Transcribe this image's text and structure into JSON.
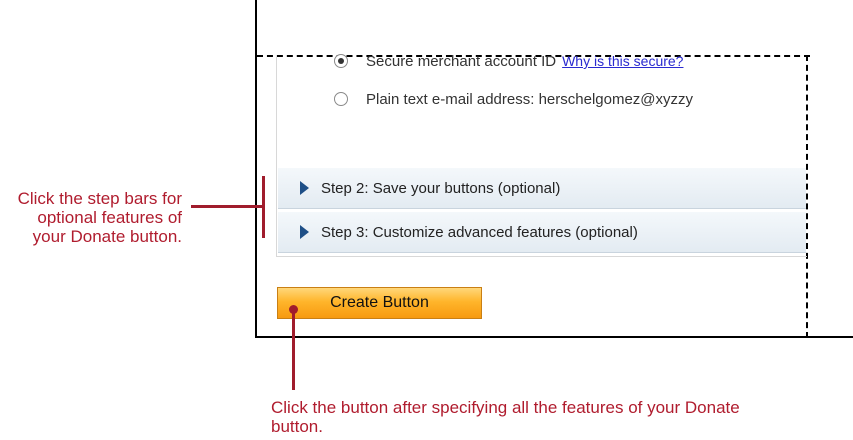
{
  "merchant_options": {
    "secure_id": {
      "label": "Secure merchant account ID",
      "link": "Why is this secure?",
      "selected": true
    },
    "email": {
      "label": "Plain text e-mail address: herschelgomez@xyzzy",
      "selected": false
    }
  },
  "steps": [
    {
      "label": "Step 2: Save your buttons (optional)"
    },
    {
      "label": "Step 3: Customize advanced features (optional)"
    }
  ],
  "create_button": {
    "label": "Create Button"
  },
  "annotations": {
    "step_bars": "Click the step bars for optional features of your Donate button.",
    "button": "Click the button after specifying all the features of your Donate button."
  },
  "colors": {
    "annotation": "#b01c2e",
    "button_orange": "#ffb52b",
    "step_triangle": "#1e4f87",
    "link": "#2a2ad0"
  }
}
